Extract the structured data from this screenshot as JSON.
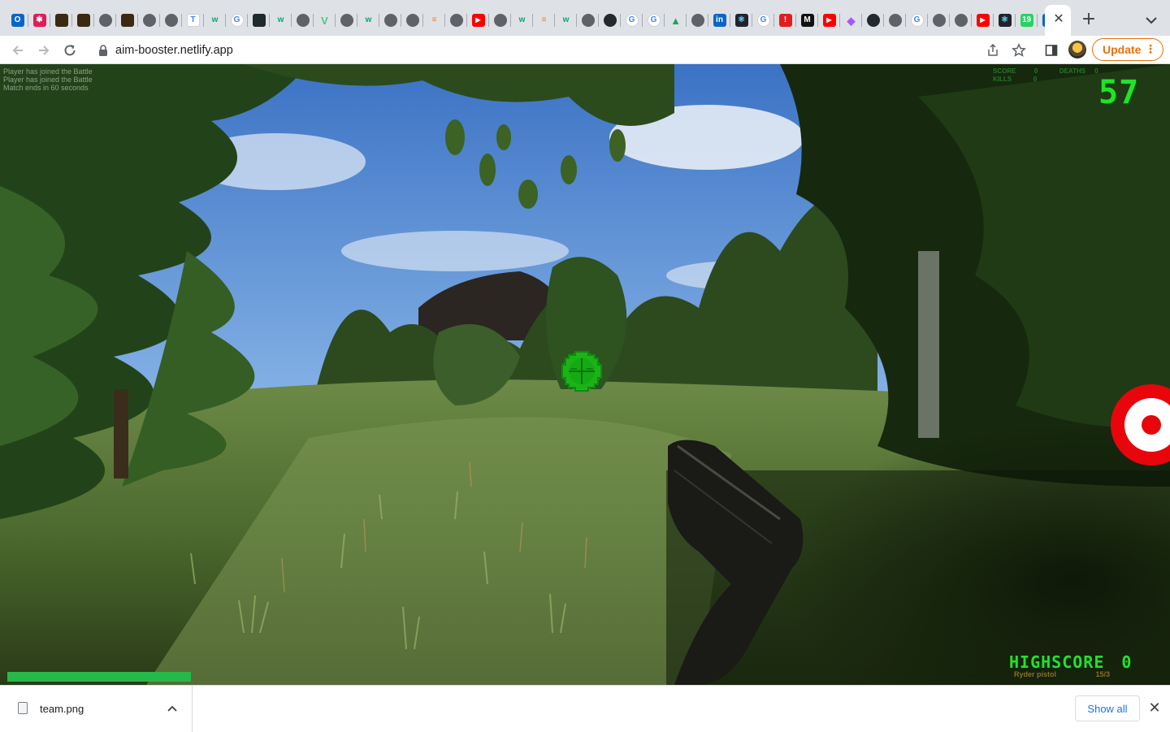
{
  "browser": {
    "tabs": [
      {
        "icon": "outlook-icon",
        "glyph": "O",
        "color": "#0a64c8"
      },
      {
        "icon": "asterisk-icon",
        "glyph": "✱",
        "color": "#e21b5a"
      },
      {
        "icon": "brand-tile-icon",
        "glyph": "",
        "color": "#3a2a10"
      },
      {
        "icon": "brand-tile-icon",
        "glyph": "",
        "color": "#3a2a10"
      },
      {
        "icon": "globe-icon",
        "glyph": "",
        "color": "#5f6368"
      },
      {
        "icon": "brand-tile-icon",
        "glyph": "",
        "color": "#3a2a10"
      },
      {
        "icon": "globe-icon",
        "glyph": "",
        "color": "#5f6368"
      },
      {
        "icon": "globe-icon",
        "glyph": "",
        "color": "#5f6368"
      },
      {
        "icon": "typora-icon",
        "glyph": "T",
        "color": "#ffffff"
      },
      {
        "icon": "w3schools-icon",
        "glyph": "w",
        "color": "#04aa6d"
      },
      {
        "icon": "google-icon",
        "glyph": "G",
        "color": "#ffffff"
      },
      {
        "icon": "cursor-app-icon",
        "glyph": "",
        "color": "#1f2a2a"
      },
      {
        "icon": "w3schools-icon",
        "glyph": "w",
        "color": "#04aa6d"
      },
      {
        "icon": "chrome-icon",
        "glyph": "",
        "color": "#5f6368"
      },
      {
        "icon": "vuetify-icon",
        "glyph": "V",
        "color": "#3fcf7e"
      },
      {
        "icon": "globe-icon",
        "glyph": "",
        "color": "#5f6368"
      },
      {
        "icon": "w3schools-icon",
        "glyph": "w",
        "color": "#04aa6d"
      },
      {
        "icon": "globe-icon",
        "glyph": "",
        "color": "#5f6368"
      },
      {
        "icon": "globe-icon",
        "glyph": "",
        "color": "#5f6368"
      },
      {
        "icon": "stackoverflow-icon",
        "glyph": "≡",
        "color": "#f48024"
      },
      {
        "icon": "chrome-icon",
        "glyph": "",
        "color": "#5f6368"
      },
      {
        "icon": "youtube-icon",
        "glyph": "▶",
        "color": "#ff0000"
      },
      {
        "icon": "globe-icon",
        "glyph": "",
        "color": "#5f6368"
      },
      {
        "icon": "w3schools-icon",
        "glyph": "w",
        "color": "#04aa6d"
      },
      {
        "icon": "stackoverflow-icon",
        "glyph": "≡",
        "color": "#f48024"
      },
      {
        "icon": "w3schools-icon",
        "glyph": "w",
        "color": "#04aa6d"
      },
      {
        "icon": "globe-icon",
        "glyph": "",
        "color": "#5f6368"
      },
      {
        "icon": "github-icon",
        "glyph": "",
        "color": "#24292e"
      },
      {
        "icon": "google-icon",
        "glyph": "G",
        "color": "#ffffff"
      },
      {
        "icon": "google-icon",
        "glyph": "G",
        "color": "#ffffff"
      },
      {
        "icon": "google-drive-icon",
        "glyph": "▲",
        "color": "#1fa463"
      },
      {
        "icon": "chrome-icon",
        "glyph": "",
        "color": "#5f6368"
      },
      {
        "icon": "linkedin-icon",
        "glyph": "in",
        "color": "#0a66c2"
      },
      {
        "icon": "react-icon",
        "glyph": "⚛",
        "color": "#20232a"
      },
      {
        "icon": "google-icon",
        "glyph": "G",
        "color": "#ffffff"
      },
      {
        "icon": "alert-icon",
        "glyph": "!",
        "color": "#e01e1e"
      },
      {
        "icon": "medium-icon",
        "glyph": "M",
        "color": "#111111"
      },
      {
        "icon": "youtube-icon",
        "glyph": "▶",
        "color": "#ff0000"
      },
      {
        "icon": "figma-icon",
        "glyph": "◆",
        "color": "#a259ff"
      },
      {
        "icon": "github-icon",
        "glyph": "",
        "color": "#24292e"
      },
      {
        "icon": "chrome-icon",
        "glyph": "",
        "color": "#5f6368"
      },
      {
        "icon": "google-icon",
        "glyph": "G",
        "color": "#ffffff"
      },
      {
        "icon": "globe-icon",
        "glyph": "",
        "color": "#5f6368"
      },
      {
        "icon": "chrome-icon",
        "glyph": "",
        "color": "#5f6368"
      },
      {
        "icon": "youtube-icon",
        "glyph": "▶",
        "color": "#ff0000"
      },
      {
        "icon": "react-icon",
        "glyph": "⚛",
        "color": "#20232a"
      },
      {
        "icon": "whatsapp-icon",
        "glyph": "19",
        "color": "#25d366"
      },
      {
        "icon": "linkedin-icon",
        "glyph": "in",
        "color": "#0a66c2"
      }
    ],
    "active_tab": {
      "close_icon": "close-icon"
    },
    "url": "aim-booster.netlify.app",
    "update_label": "Update",
    "update_color": "#e8710a"
  },
  "game": {
    "hud_log": [
      "Player has joined the Battle",
      "Player has joined the Battle",
      "Match ends in 60 seconds"
    ],
    "hud_stats": {
      "score_label": "SCORE",
      "score_value": "0",
      "kills_label": "KILLS",
      "kills_value": "0",
      "deaths_label": "DEATHS",
      "deaths_value": "0"
    },
    "timer": "57",
    "highscore_label": "HIGHSCORE",
    "highscore_value": "0",
    "weapon_name": "Ryder pistol",
    "ammo": "15/3",
    "health_fraction": 1.0,
    "hud_color": "#22e22a",
    "target_color": "#e8050c"
  },
  "downloads": {
    "file_name": "team.png",
    "show_all_label": "Show all"
  }
}
